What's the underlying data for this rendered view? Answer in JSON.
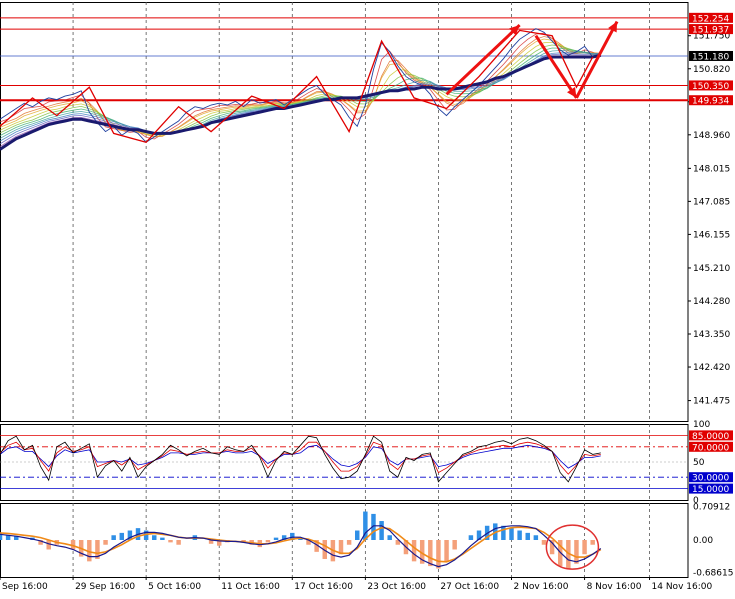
{
  "chart_data": {
    "type": "line",
    "symbol_note": "",
    "price_panel": {
      "ylim": [
        140.9,
        152.7
      ],
      "y_ticks": [
        "151.750",
        "150.820",
        "149.890",
        "148.960",
        "148.015",
        "147.085",
        "146.155",
        "145.210",
        "144.280",
        "143.350",
        "142.420",
        "141.475"
      ],
      "y_tick_values": [
        151.75,
        150.82,
        149.89,
        148.96,
        148.015,
        147.085,
        146.155,
        145.21,
        144.28,
        143.35,
        142.42,
        141.475
      ],
      "current_price": "151.180",
      "current_price_value": 151.18,
      "levels": [
        {
          "label": "152.254",
          "value": 152.254,
          "color": "#e00000"
        },
        {
          "label": "151.937",
          "value": 151.937,
          "color": "#e00000"
        },
        {
          "label": "150.350",
          "value": 150.35,
          "color": "#e00000"
        },
        {
          "label": "149.934",
          "value": 149.934,
          "color": "#e00000"
        }
      ],
      "price_series": [
        149.4,
        149.55,
        149.7,
        149.85,
        149.75,
        149.9,
        150.0,
        149.95,
        150.05,
        150.1,
        150.2,
        149.6,
        149.3,
        149.05,
        149.2,
        148.95,
        149.1,
        149.0,
        148.75,
        148.9,
        149.05,
        149.2,
        149.35,
        149.6,
        149.75,
        149.7,
        149.8,
        149.85,
        149.8,
        149.9,
        149.75,
        149.95,
        149.85,
        149.9,
        149.95,
        149.8,
        149.95,
        150.1,
        150.25,
        150.35,
        150.1,
        149.95,
        149.8,
        149.45,
        149.2,
        149.8,
        150.8,
        151.55,
        151.3,
        150.9,
        150.6,
        150.45,
        150.35,
        150.1,
        149.7,
        149.5,
        149.75,
        149.95,
        150.15,
        150.35,
        150.6,
        150.85,
        151.1,
        151.4,
        151.65,
        151.8,
        151.95,
        151.85,
        151.6,
        151.35,
        151.2,
        151.3,
        151.45,
        151.15,
        151.2
      ],
      "ma_series": [
        148.55,
        148.7,
        148.85,
        148.95,
        149.05,
        149.15,
        149.25,
        149.3,
        149.35,
        149.4,
        149.4,
        149.35,
        149.3,
        149.25,
        149.2,
        149.15,
        149.1,
        149.1,
        149.05,
        149.0,
        149.0,
        149.0,
        149.05,
        149.1,
        149.15,
        149.2,
        149.3,
        149.35,
        149.4,
        149.45,
        149.5,
        149.55,
        149.6,
        149.65,
        149.7,
        149.7,
        149.75,
        149.8,
        149.85,
        149.9,
        149.95,
        149.95,
        150.0,
        150.0,
        150.0,
        150.05,
        150.1,
        150.15,
        150.2,
        150.2,
        150.25,
        150.25,
        150.3,
        150.3,
        150.25,
        150.25,
        150.25,
        150.3,
        150.35,
        150.4,
        150.45,
        150.55,
        150.6,
        150.7,
        150.8,
        150.9,
        151.0,
        151.1,
        151.15,
        151.15,
        151.15,
        151.15,
        151.15,
        151.15,
        151.2
      ],
      "zigzag": [
        [
          0,
          149.2
        ],
        [
          4,
          150.0
        ],
        [
          7,
          149.5
        ],
        [
          11,
          150.3
        ],
        [
          14,
          149.0
        ],
        [
          18,
          148.75
        ],
        [
          22,
          149.75
        ],
        [
          26,
          149.05
        ],
        [
          31,
          150.05
        ],
        [
          35,
          149.7
        ],
        [
          39,
          150.6
        ],
        [
          43,
          149.05
        ],
        [
          47,
          151.6
        ],
        [
          51,
          150.0
        ],
        [
          55,
          149.7
        ],
        [
          59,
          150.6
        ],
        [
          64,
          151.9
        ],
        [
          68,
          151.75
        ],
        [
          71,
          150.3
        ],
        [
          73,
          151.15
        ]
      ],
      "arrows": [
        {
          "from": [
            55,
            150.1
          ],
          "to": [
            64,
            152.05
          ]
        },
        {
          "from": [
            66,
            151.75
          ],
          "to": [
            71,
            150.0
          ]
        },
        {
          "from": [
            71,
            150.0
          ],
          "to": [
            76,
            152.15
          ]
        }
      ]
    },
    "rsi_panel": {
      "ylim": [
        0,
        100
      ],
      "y_ticks": [
        "100",
        "50",
        "0"
      ],
      "y_tick_values": [
        100,
        50,
        0
      ],
      "levels": [
        {
          "label": "85.0000",
          "value": 85,
          "color": "#e00000"
        },
        {
          "label": "70.0000",
          "value": 70,
          "color": "#e00000"
        },
        {
          "label": "30.0000",
          "value": 30,
          "color": "#0000cc"
        },
        {
          "label": "15.0000",
          "value": 15,
          "color": "#0000cc"
        }
      ],
      "series_black": [
        60,
        78,
        84,
        66,
        72,
        44,
        26,
        70,
        76,
        62,
        68,
        74,
        30,
        45,
        52,
        38,
        56,
        30,
        44,
        52,
        60,
        72,
        66,
        58,
        64,
        68,
        62,
        60,
        70,
        66,
        64,
        72,
        56,
        30,
        52,
        64,
        60,
        72,
        84,
        82,
        60,
        42,
        28,
        30,
        38,
        60,
        84,
        76,
        38,
        30,
        56,
        52,
        60,
        62,
        24,
        36,
        48,
        60,
        64,
        70,
        72,
        76,
        78,
        74,
        80,
        82,
        78,
        72,
        64,
        36,
        24,
        44,
        66,
        60,
        62
      ],
      "series_red": [
        62,
        72,
        76,
        66,
        68,
        52,
        38,
        62,
        70,
        64,
        66,
        70,
        44,
        48,
        52,
        46,
        54,
        40,
        46,
        52,
        58,
        66,
        64,
        60,
        62,
        64,
        62,
        62,
        66,
        64,
        64,
        68,
        58,
        42,
        54,
        62,
        60,
        66,
        76,
        76,
        64,
        50,
        38,
        38,
        44,
        58,
        76,
        72,
        48,
        40,
        54,
        54,
        58,
        60,
        36,
        42,
        50,
        58,
        62,
        66,
        68,
        70,
        72,
        70,
        74,
        76,
        74,
        70,
        64,
        46,
        34,
        46,
        60,
        58,
        60
      ],
      "series_blue": [
        60,
        68,
        70,
        64,
        64,
        54,
        44,
        58,
        66,
        62,
        64,
        66,
        50,
        50,
        52,
        50,
        54,
        46,
        48,
        52,
        56,
        62,
        62,
        60,
        60,
        62,
        62,
        62,
        64,
        62,
        62,
        64,
        58,
        48,
        54,
        60,
        60,
        62,
        70,
        72,
        64,
        54,
        46,
        44,
        48,
        56,
        70,
        68,
        52,
        46,
        54,
        54,
        56,
        58,
        44,
        46,
        50,
        56,
        60,
        62,
        64,
        66,
        68,
        68,
        70,
        72,
        70,
        68,
        64,
        52,
        42,
        48,
        56,
        56,
        58
      ]
    },
    "macd_panel": {
      "ylim": [
        -0.78,
        0.78
      ],
      "y_ticks": [
        "0.70912",
        "0.00",
        "-0.68615"
      ],
      "y_tick_values": [
        0.70912,
        0.0,
        -0.68615
      ],
      "histogram": [
        0.15,
        0.1,
        0.08,
        0.0,
        0.05,
        -0.1,
        -0.2,
        -0.1,
        0.0,
        -0.2,
        -0.35,
        -0.45,
        -0.4,
        -0.1,
        0.1,
        0.15,
        0.2,
        0.25,
        0.2,
        0.1,
        0.05,
        -0.05,
        -0.1,
        0.0,
        0.1,
        0.0,
        -0.08,
        -0.12,
        -0.05,
        0.0,
        -0.05,
        -0.1,
        -0.15,
        -0.05,
        0.05,
        0.1,
        0.15,
        0.05,
        -0.1,
        -0.25,
        -0.4,
        -0.45,
        -0.3,
        -0.1,
        0.2,
        0.6,
        0.55,
        0.4,
        0.1,
        -0.1,
        -0.3,
        -0.45,
        -0.5,
        -0.55,
        -0.6,
        -0.45,
        -0.2,
        0.0,
        0.1,
        0.2,
        0.3,
        0.35,
        0.3,
        0.25,
        0.2,
        0.15,
        0.1,
        -0.1,
        -0.3,
        -0.55,
        -0.6,
        -0.5,
        -0.3,
        -0.1,
        0.0
      ],
      "signal": [
        0.15,
        0.14,
        0.12,
        0.1,
        0.08,
        0.05,
        0.0,
        -0.05,
        -0.08,
        -0.12,
        -0.18,
        -0.25,
        -0.28,
        -0.25,
        -0.18,
        -0.1,
        0.0,
        0.08,
        0.12,
        0.14,
        0.12,
        0.1,
        0.06,
        0.04,
        0.04,
        0.04,
        0.02,
        0.0,
        -0.02,
        -0.03,
        -0.04,
        -0.06,
        -0.08,
        -0.08,
        -0.06,
        -0.02,
        0.02,
        0.04,
        0.02,
        -0.04,
        -0.12,
        -0.22,
        -0.28,
        -0.28,
        -0.18,
        0.02,
        0.18,
        0.26,
        0.24,
        0.12,
        -0.02,
        -0.16,
        -0.28,
        -0.38,
        -0.45,
        -0.46,
        -0.4,
        -0.3,
        -0.18,
        -0.06,
        0.06,
        0.16,
        0.22,
        0.26,
        0.27,
        0.26,
        0.24,
        0.16,
        0.04,
        -0.12,
        -0.28,
        -0.36,
        -0.36,
        -0.3,
        -0.2
      ],
      "macd_line": [
        0.12,
        0.1,
        0.08,
        0.05,
        0.02,
        -0.02,
        -0.08,
        -0.12,
        -0.15,
        -0.2,
        -0.28,
        -0.35,
        -0.35,
        -0.28,
        -0.15,
        -0.05,
        0.05,
        0.12,
        0.16,
        0.16,
        0.14,
        0.1,
        0.06,
        0.04,
        0.05,
        0.04,
        0.0,
        -0.02,
        -0.03,
        -0.03,
        -0.05,
        -0.08,
        -0.1,
        -0.08,
        -0.04,
        0.02,
        0.06,
        0.06,
        0.0,
        -0.1,
        -0.22,
        -0.32,
        -0.36,
        -0.32,
        -0.15,
        0.15,
        0.3,
        0.3,
        0.2,
        0.02,
        -0.15,
        -0.3,
        -0.42,
        -0.5,
        -0.56,
        -0.52,
        -0.42,
        -0.28,
        -0.12,
        0.02,
        0.14,
        0.24,
        0.28,
        0.3,
        0.3,
        0.28,
        0.24,
        0.1,
        -0.06,
        -0.26,
        -0.42,
        -0.46,
        -0.4,
        -0.3,
        -0.18
      ]
    },
    "x_axis": {
      "labels": [
        "Sep 16:00",
        "29 Sep 16:00",
        "5 Oct 16:00",
        "11 Oct 16:00",
        "17 Oct 16:00",
        "23 Oct 16:00",
        "27 Oct 16:00",
        "2 Nov 16:00",
        "8 Nov 16:00",
        "14 Nov 16:00"
      ],
      "label_positions": [
        0,
        9,
        18,
        27,
        36,
        45,
        54,
        63,
        72,
        80
      ],
      "period_separators": [
        9,
        18,
        27,
        36,
        45,
        54,
        63,
        72,
        80
      ],
      "x_max": 84
    },
    "colors": {
      "level_red": "#e00000",
      "ma_navy": "#1a1a6e",
      "price_line": "#2040a0",
      "zigzag": "#e00000",
      "arrow": "#ee1111",
      "hist_up": "#2f8fe6",
      "hist_down": "#f4a07a",
      "signal": "#f08a18",
      "macd": "#1a1a8e",
      "circle": "#e03030",
      "rsi_red": "#e00000",
      "rsi_blue": "#0000cc"
    }
  }
}
